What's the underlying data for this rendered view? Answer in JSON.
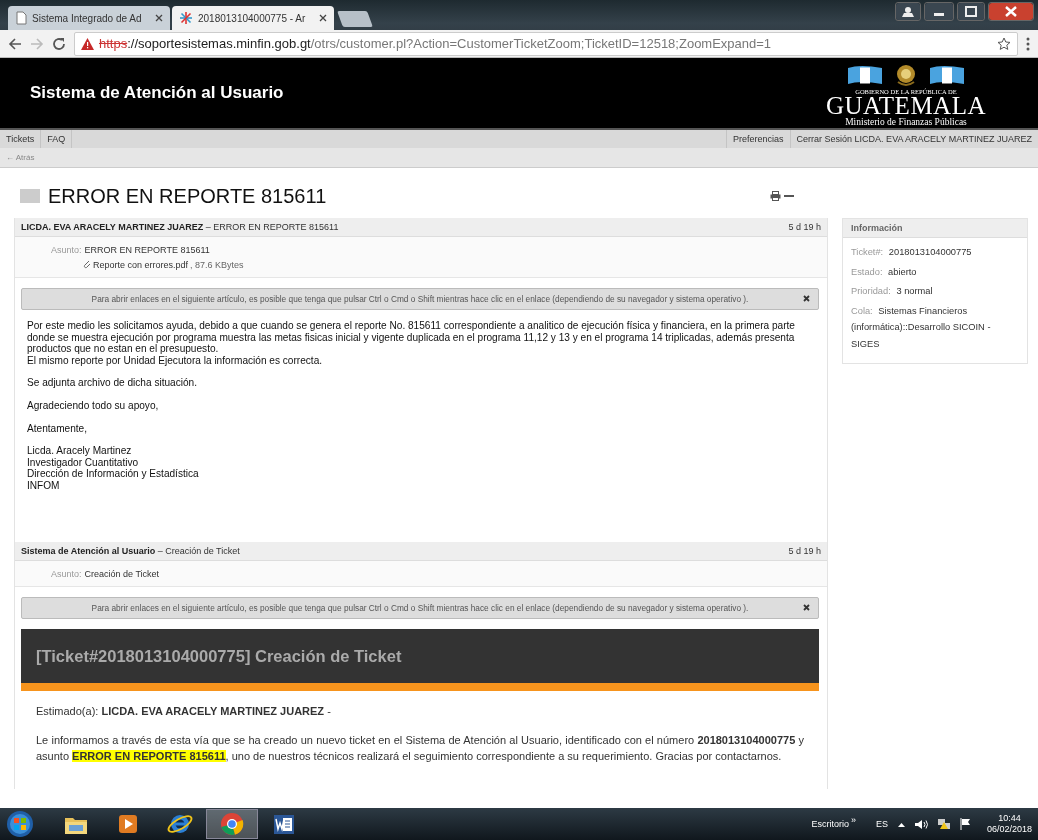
{
  "browser": {
    "tabs": [
      {
        "title": "Sistema Integrado de Ad",
        "kind": "page",
        "selected": false
      },
      {
        "title": "2018013104000775 - Ar",
        "kind": "asterisk",
        "selected": true
      }
    ],
    "url": {
      "insecure": true,
      "scheme": "https",
      "host": "://soportesistemas.minfin.gob.gt",
      "path": "/otrs/customer.pl?Action=CustomerTicketZoom;TicketID=12518;ZoomExpand=1"
    }
  },
  "header": {
    "title": "Sistema de Atención al Usuario",
    "logo": {
      "top": "GOBIERNO DE LA REPÚBLICA DE",
      "name": "GUATEMALA",
      "sub": "Ministerio de Finanzas Públicas"
    }
  },
  "nav": {
    "left": [
      "Tickets",
      "FAQ"
    ],
    "right": [
      "Preferencias",
      "Cerrar Sesión LICDA. EVA ARACELY MARTINEZ JUAREZ"
    ]
  },
  "back": "← Atrás",
  "ticket": {
    "title": "ERROR EN REPORTE 815611"
  },
  "articles": [
    {
      "sender": "LICDA. EVA ARACELY MARTINEZ JUAREZ",
      "subject": "– ERROR EN REPORTE 815611",
      "age": "5 d 19 h",
      "fields": [
        {
          "label": "Asunto:",
          "value": "ERROR EN REPORTE 815611"
        }
      ],
      "attachment": {
        "name": "Reporte con errores.pdf",
        "size": ", 87.6 KBytes"
      },
      "notice": "Para abrir enlaces en el siguiente artículo, es posible que tenga que pulsar Ctrl o Cmd o Shift mientras hace clic en el enlace (dependiendo de su navegador y sistema operativo ).",
      "body": {
        "kind": "text",
        "paragraphs": [
          [
            "Por este medio les solicitamos ayuda, debido a que cuando se genera el reporte No. 815611 correspondiente a analitico de ejecución física y financiera, en la primera parte donde se muestra ejecución por programa muestra las metas fisicas inicial y vigente duplicada en el programa 11,12 y 13 y en el programa 14 triplicadas, además presenta productos que no estan en el presupuesto.",
            "El mismo reporte por Unidad Ejecutora la información es correcta."
          ],
          [
            "Se adjunta archivo de dicha situación."
          ],
          [
            "Agradeciendo todo su apoyo,"
          ],
          [
            "Atentamente,"
          ],
          [
            "Licda. Aracely Martinez",
            "Investigador Cuantitativo",
            "Dirección de Información y Estadística",
            "INFOM"
          ]
        ]
      }
    },
    {
      "sender": "Sistema de Atención al Usuario",
      "subject": "– Creación de Ticket",
      "age": "5 d 19 h",
      "fields": [
        {
          "label": "Asunto:",
          "value": "Creación de Ticket"
        }
      ],
      "notice": "Para abrir enlaces en el siguiente artículo, es posible que tenga que pulsar Ctrl o Cmd o Shift mientras hace clic en el enlace (dependiendo de su navegador y sistema operativo ).",
      "body": {
        "kind": "email",
        "heading": "[Ticket#2018013104000775] Creación de Ticket",
        "paragraphs": [
          [
            {
              "text": "Estimado(a): **LICDA. EVA ARACELY MARTINEZ JUAREZ** -",
              "highlight": false
            }
          ],
          [
            {
              "text": "Le informamos a través de esta vía que se ha creado un nuevo ticket en el Sistema de Atención al Usuario, identificado con el número **2018013104000775** y asunto ",
              "highlight": false
            },
            {
              "text": "**ERROR EN REPORTE 815611**",
              "highlight": true
            },
            {
              "text": ", uno de nuestros técnicos realizará el seguimiento correspondiente a su requerimiento. Gracias por contactarnos.",
              "highlight": false
            }
          ]
        ]
      }
    }
  ],
  "info": {
    "title": "Información",
    "fields": [
      {
        "label": "Ticket#:",
        "value": "2018013104000775"
      },
      {
        "label": "Estado:",
        "value": "abierto"
      },
      {
        "label": "Prioridad:",
        "value": "3 normal"
      },
      {
        "label": "Cola:",
        "value": "Sistemas Financieros (informática)::Desarrollo SICOIN - SIGES"
      }
    ]
  },
  "taskbar": {
    "apps": [
      {
        "kind": "folder",
        "selected": false
      },
      {
        "kind": "media",
        "selected": false
      },
      {
        "kind": "ie",
        "selected": false
      },
      {
        "kind": "chrome",
        "selected": true
      },
      {
        "kind": "word",
        "selected": false
      }
    ],
    "toolbar": "Escritorio",
    "chevron": "»",
    "lang": "ES",
    "time": "10:44",
    "date": "06/02/2018"
  }
}
